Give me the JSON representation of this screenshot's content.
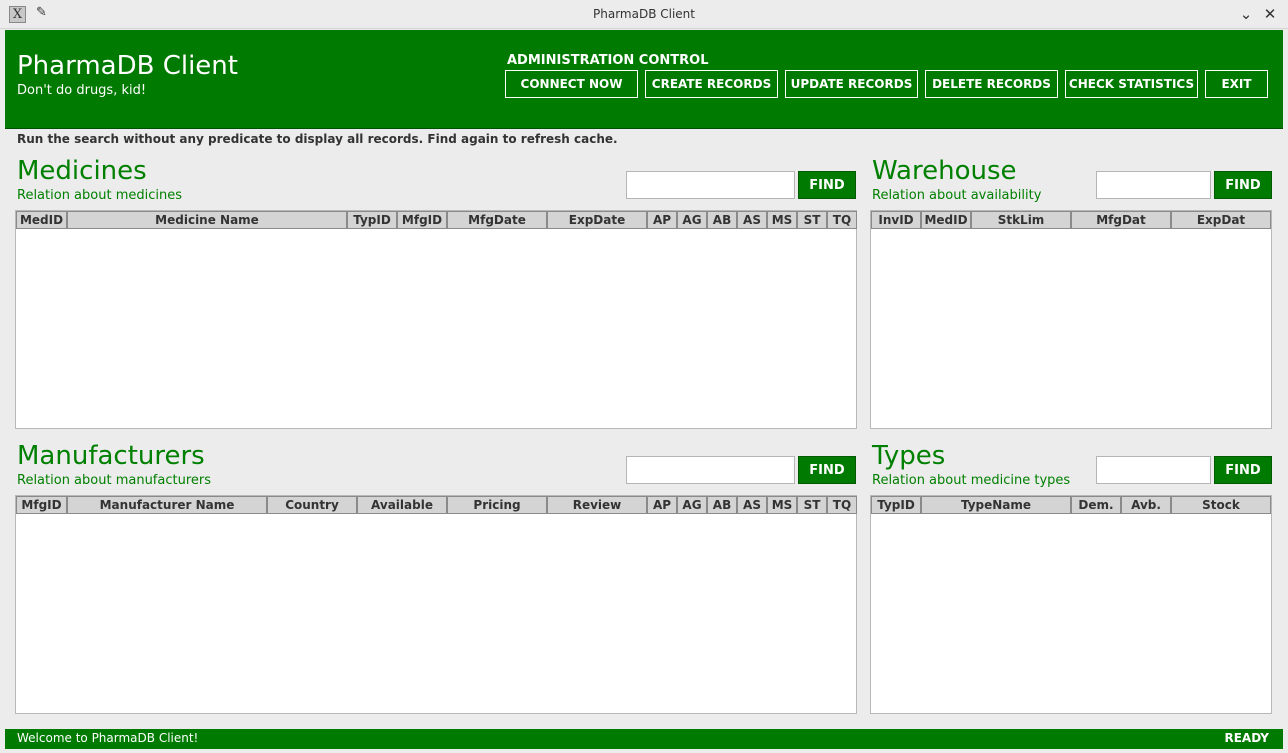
{
  "window": {
    "title": "PharmaDB Client"
  },
  "header": {
    "title": "PharmaDB Client",
    "subtitle": "Don't do drugs, kid!",
    "admin_label": "ADMINISTRATION CONTROL",
    "buttons": {
      "connect": "CONNECT NOW",
      "create": "CREATE RECORDS",
      "update": "UPDATE RECORDS",
      "delete": "DELETE RECORDS",
      "statistics": "CHECK STATISTICS",
      "exit": "EXIT"
    }
  },
  "hint": "Run the search without any predicate to display all records. Find again to refresh cache.",
  "find_label": "FIND",
  "medicines": {
    "title": "Medicines",
    "subtitle": "Relation about medicines",
    "columns": [
      "MedID",
      "Medicine Name",
      "TypID",
      "MfgID",
      "MfgDate",
      "ExpDate",
      "AP",
      "AG",
      "AB",
      "AS",
      "MS",
      "ST",
      "TQ"
    ],
    "search_value": ""
  },
  "warehouse": {
    "title": "Warehouse",
    "subtitle": "Relation about availability",
    "columns": [
      "InvID",
      "MedID",
      "StkLim",
      "MfgDat",
      "ExpDat"
    ],
    "search_value": ""
  },
  "manufacturers": {
    "title": "Manufacturers",
    "subtitle": "Relation about manufacturers",
    "columns": [
      "MfgID",
      "Manufacturer Name",
      "Country",
      "Available",
      "Pricing",
      "Review",
      "AP",
      "AG",
      "AB",
      "AS",
      "MS",
      "ST",
      "TQ"
    ],
    "search_value": ""
  },
  "types": {
    "title": "Types",
    "subtitle": "Relation about medicine types",
    "columns": [
      "TypID",
      "TypeName",
      "Dem.",
      "Avb.",
      "Stock"
    ],
    "search_value": ""
  },
  "status": {
    "message": "Welcome to PharmaDB Client!",
    "state": "READY"
  },
  "colors": {
    "accent": "#007a00",
    "text_green": "#008000",
    "background": "#ececec"
  }
}
